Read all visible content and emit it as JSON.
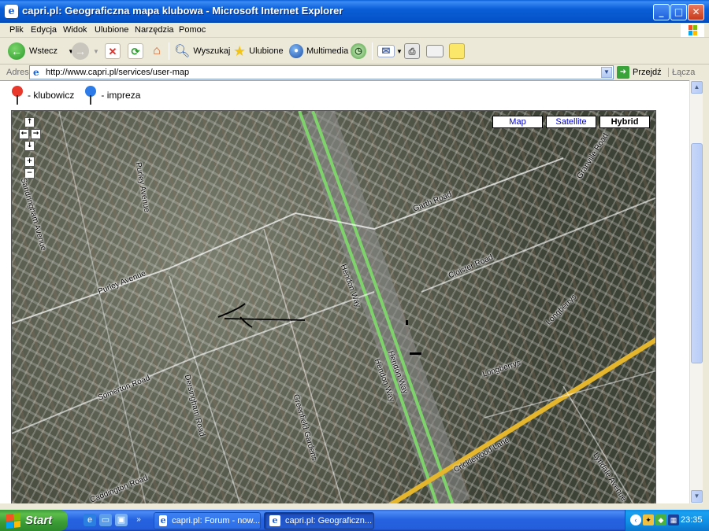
{
  "window": {
    "title": "capri.pl: Geograficzna mapa klubowa - Microsoft Internet Explorer",
    "min_label": "_",
    "max_label": "□",
    "close_label": "✕"
  },
  "menu": [
    "Plik",
    "Edycja",
    "Widok",
    "Ulubione",
    "Narzędzia",
    "Pomoc"
  ],
  "toolbar": {
    "back_label": "Wstecz",
    "search_label": "Wyszukaj",
    "favorites_label": "Ulubione",
    "media_label": "Multimedia"
  },
  "address": {
    "label": "Adres",
    "url": "http://www.capri.pl/services/user-map",
    "go_label": "Przejdź",
    "links_label": "Łącza"
  },
  "legend": {
    "member_label": "- klubowicz",
    "event_label": "- impreza",
    "member_color": "#e8382c",
    "event_color": "#2c7be8"
  },
  "map": {
    "types": [
      "Map",
      "Satellite",
      "Hybrid"
    ],
    "active_type": "Hybrid",
    "pan_up": "↑",
    "pan_left": "←",
    "pan_right": "→",
    "pan_down": "↓",
    "zoom_in": "+",
    "zoom_out": "−",
    "streets": {
      "purley_avenue_1": "Purley Avenue",
      "purley_avenue_2": "Purley Avenue",
      "sandringham": "Sandringham Avenue",
      "garth_road": "Garth Road",
      "granville_road": "Granville Road",
      "cloister_road": "Cloister Road",
      "hendon_way_1": "Hendon Way",
      "hendon_way_2": "Hendon Way",
      "hendon_way_3": "Hendon Way",
      "longberrys_1": "Longberrys",
      "longberrys_2": "Longberrys",
      "somerton_road": "Somerton Road",
      "dersingham_road": "Dersingham Road",
      "greenfield_gardens": "Greenfield Gardens",
      "cricklewood_lane": "Cricklewood Lane",
      "lyndale_avenue": "Lyndale Avenue",
      "caddington_road": "Caddington Road"
    }
  },
  "taskbar": {
    "start_label": "Start",
    "tasks": [
      {
        "label": "capri.pl: Forum - now...",
        "active": false
      },
      {
        "label": "capri.pl: Geograficzn...",
        "active": true
      }
    ],
    "clock": "23:35"
  }
}
